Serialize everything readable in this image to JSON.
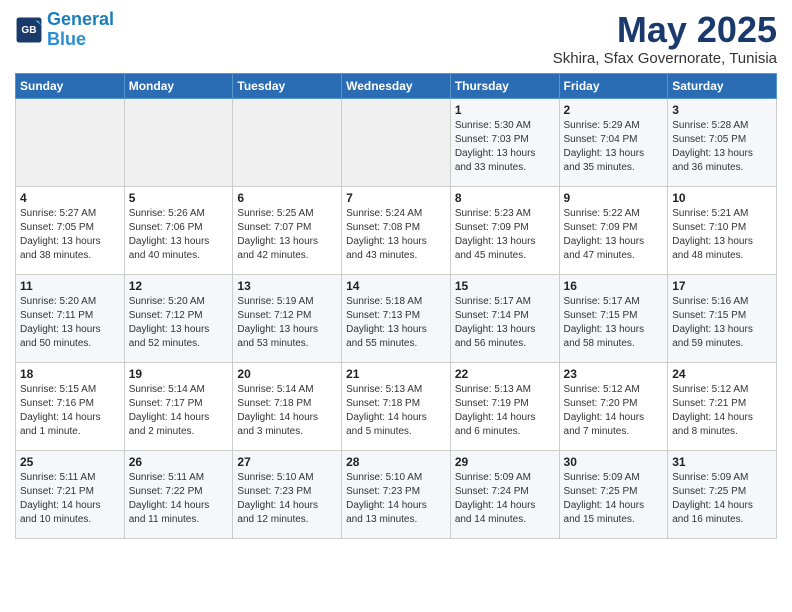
{
  "logo": {
    "line1": "General",
    "line2": "Blue"
  },
  "title": "May 2025",
  "subtitle": "Skhira, Sfax Governorate, Tunisia",
  "headers": [
    "Sunday",
    "Monday",
    "Tuesday",
    "Wednesday",
    "Thursday",
    "Friday",
    "Saturday"
  ],
  "weeks": [
    [
      {
        "day": "",
        "info": ""
      },
      {
        "day": "",
        "info": ""
      },
      {
        "day": "",
        "info": ""
      },
      {
        "day": "",
        "info": ""
      },
      {
        "day": "1",
        "info": "Sunrise: 5:30 AM\nSunset: 7:03 PM\nDaylight: 13 hours\nand 33 minutes."
      },
      {
        "day": "2",
        "info": "Sunrise: 5:29 AM\nSunset: 7:04 PM\nDaylight: 13 hours\nand 35 minutes."
      },
      {
        "day": "3",
        "info": "Sunrise: 5:28 AM\nSunset: 7:05 PM\nDaylight: 13 hours\nand 36 minutes."
      }
    ],
    [
      {
        "day": "4",
        "info": "Sunrise: 5:27 AM\nSunset: 7:05 PM\nDaylight: 13 hours\nand 38 minutes."
      },
      {
        "day": "5",
        "info": "Sunrise: 5:26 AM\nSunset: 7:06 PM\nDaylight: 13 hours\nand 40 minutes."
      },
      {
        "day": "6",
        "info": "Sunrise: 5:25 AM\nSunset: 7:07 PM\nDaylight: 13 hours\nand 42 minutes."
      },
      {
        "day": "7",
        "info": "Sunrise: 5:24 AM\nSunset: 7:08 PM\nDaylight: 13 hours\nand 43 minutes."
      },
      {
        "day": "8",
        "info": "Sunrise: 5:23 AM\nSunset: 7:09 PM\nDaylight: 13 hours\nand 45 minutes."
      },
      {
        "day": "9",
        "info": "Sunrise: 5:22 AM\nSunset: 7:09 PM\nDaylight: 13 hours\nand 47 minutes."
      },
      {
        "day": "10",
        "info": "Sunrise: 5:21 AM\nSunset: 7:10 PM\nDaylight: 13 hours\nand 48 minutes."
      }
    ],
    [
      {
        "day": "11",
        "info": "Sunrise: 5:20 AM\nSunset: 7:11 PM\nDaylight: 13 hours\nand 50 minutes."
      },
      {
        "day": "12",
        "info": "Sunrise: 5:20 AM\nSunset: 7:12 PM\nDaylight: 13 hours\nand 52 minutes."
      },
      {
        "day": "13",
        "info": "Sunrise: 5:19 AM\nSunset: 7:12 PM\nDaylight: 13 hours\nand 53 minutes."
      },
      {
        "day": "14",
        "info": "Sunrise: 5:18 AM\nSunset: 7:13 PM\nDaylight: 13 hours\nand 55 minutes."
      },
      {
        "day": "15",
        "info": "Sunrise: 5:17 AM\nSunset: 7:14 PM\nDaylight: 13 hours\nand 56 minutes."
      },
      {
        "day": "16",
        "info": "Sunrise: 5:17 AM\nSunset: 7:15 PM\nDaylight: 13 hours\nand 58 minutes."
      },
      {
        "day": "17",
        "info": "Sunrise: 5:16 AM\nSunset: 7:15 PM\nDaylight: 13 hours\nand 59 minutes."
      }
    ],
    [
      {
        "day": "18",
        "info": "Sunrise: 5:15 AM\nSunset: 7:16 PM\nDaylight: 14 hours\nand 1 minute."
      },
      {
        "day": "19",
        "info": "Sunrise: 5:14 AM\nSunset: 7:17 PM\nDaylight: 14 hours\nand 2 minutes."
      },
      {
        "day": "20",
        "info": "Sunrise: 5:14 AM\nSunset: 7:18 PM\nDaylight: 14 hours\nand 3 minutes."
      },
      {
        "day": "21",
        "info": "Sunrise: 5:13 AM\nSunset: 7:18 PM\nDaylight: 14 hours\nand 5 minutes."
      },
      {
        "day": "22",
        "info": "Sunrise: 5:13 AM\nSunset: 7:19 PM\nDaylight: 14 hours\nand 6 minutes."
      },
      {
        "day": "23",
        "info": "Sunrise: 5:12 AM\nSunset: 7:20 PM\nDaylight: 14 hours\nand 7 minutes."
      },
      {
        "day": "24",
        "info": "Sunrise: 5:12 AM\nSunset: 7:21 PM\nDaylight: 14 hours\nand 8 minutes."
      }
    ],
    [
      {
        "day": "25",
        "info": "Sunrise: 5:11 AM\nSunset: 7:21 PM\nDaylight: 14 hours\nand 10 minutes."
      },
      {
        "day": "26",
        "info": "Sunrise: 5:11 AM\nSunset: 7:22 PM\nDaylight: 14 hours\nand 11 minutes."
      },
      {
        "day": "27",
        "info": "Sunrise: 5:10 AM\nSunset: 7:23 PM\nDaylight: 14 hours\nand 12 minutes."
      },
      {
        "day": "28",
        "info": "Sunrise: 5:10 AM\nSunset: 7:23 PM\nDaylight: 14 hours\nand 13 minutes."
      },
      {
        "day": "29",
        "info": "Sunrise: 5:09 AM\nSunset: 7:24 PM\nDaylight: 14 hours\nand 14 minutes."
      },
      {
        "day": "30",
        "info": "Sunrise: 5:09 AM\nSunset: 7:25 PM\nDaylight: 14 hours\nand 15 minutes."
      },
      {
        "day": "31",
        "info": "Sunrise: 5:09 AM\nSunset: 7:25 PM\nDaylight: 14 hours\nand 16 minutes."
      }
    ]
  ]
}
